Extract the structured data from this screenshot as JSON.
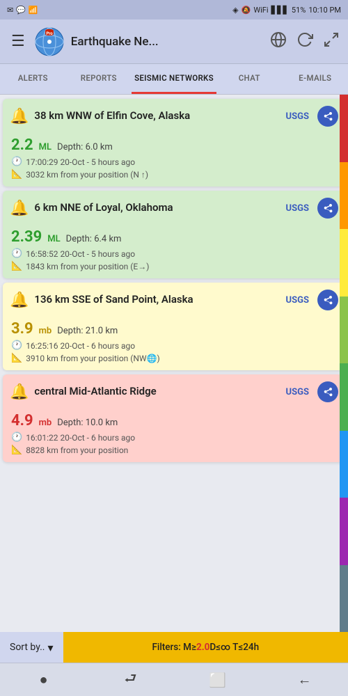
{
  "status_bar": {
    "icons_left": [
      "mail",
      "sms",
      "signal"
    ],
    "location": "◈",
    "mute": "🔇",
    "wifi": "WiFi",
    "signal_bars": "▋▋▋",
    "battery": "51%",
    "time": "10:10 PM"
  },
  "app_bar": {
    "title": "Earthquake Ne...",
    "menu_label": "☰"
  },
  "tabs": [
    {
      "label": "ALERTS",
      "active": false
    },
    {
      "label": "REPORTS",
      "active": false
    },
    {
      "label": "SEISMIC NETWORKS",
      "active": true
    },
    {
      "label": "CHAT",
      "active": false
    },
    {
      "label": "E-MAILS",
      "active": false
    }
  ],
  "earthquakes": [
    {
      "location": "38 km WNW of Elfin Cove, Alaska",
      "source": "USGS",
      "magnitude": "2.2",
      "mag_type": "ML",
      "depth_label": "Depth:",
      "depth_value": "6.0 km",
      "time": "17:00:29 20-Oct - 5 hours ago",
      "distance": "3032 km from your position (N ↑)",
      "color": "green"
    },
    {
      "location": "6 km NNE of Loyal, Oklahoma",
      "source": "USGS",
      "magnitude": "2.39",
      "mag_type": "ML",
      "depth_label": "Depth:",
      "depth_value": "6.4 km",
      "time": "16:58:52 20-Oct - 5 hours ago",
      "distance": "1843 km from your position (E→)",
      "color": "green"
    },
    {
      "location": "136 km SSE of Sand Point, Alaska",
      "source": "USGS",
      "magnitude": "3.9",
      "mag_type": "mb",
      "depth_label": "Depth:",
      "depth_value": "21.0 km",
      "time": "16:25:16 20-Oct - 6 hours ago",
      "distance": "3910 km from your position (NW🌐)",
      "color": "yellow"
    },
    {
      "location": "central Mid-Atlantic Ridge",
      "source": "USGS",
      "magnitude": "4.9",
      "mag_type": "mb",
      "depth_label": "Depth:",
      "depth_value": "10.0 km",
      "time": "16:01:22 20-Oct - 6 hours ago",
      "distance": "8828 km from your position",
      "color": "red"
    }
  ],
  "sort_bar": {
    "label": "Sort by..",
    "filter_prefix": "Filters: M≥",
    "filter_mag": "2.0",
    "filter_rest": " D≤∞ T≤24h"
  },
  "bottom_nav": {
    "dot": "●",
    "routing": "⮐",
    "square": "□",
    "back": "←"
  }
}
